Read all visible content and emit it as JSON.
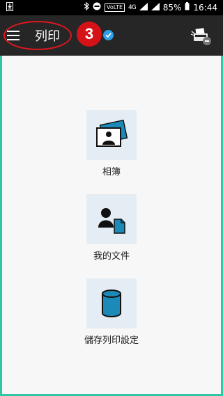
{
  "status_bar": {
    "volte": "VoLTE",
    "network": "4G",
    "battery": "85%",
    "time": "16:44"
  },
  "app_bar": {
    "title": "列印",
    "annotation_number": "3"
  },
  "tiles": [
    {
      "label": "相簿",
      "icon": "photo-album-icon"
    },
    {
      "label": "我的文件",
      "icon": "my-documents-icon"
    },
    {
      "label": "儲存列印設定",
      "icon": "saved-settings-icon"
    }
  ],
  "colors": {
    "app_bar": "#262626",
    "accent_blue": "#1b8ab8",
    "annotation_red": "#d51217",
    "frame_border": "#2fc6a3",
    "tile_bg": "#e4edf3"
  }
}
